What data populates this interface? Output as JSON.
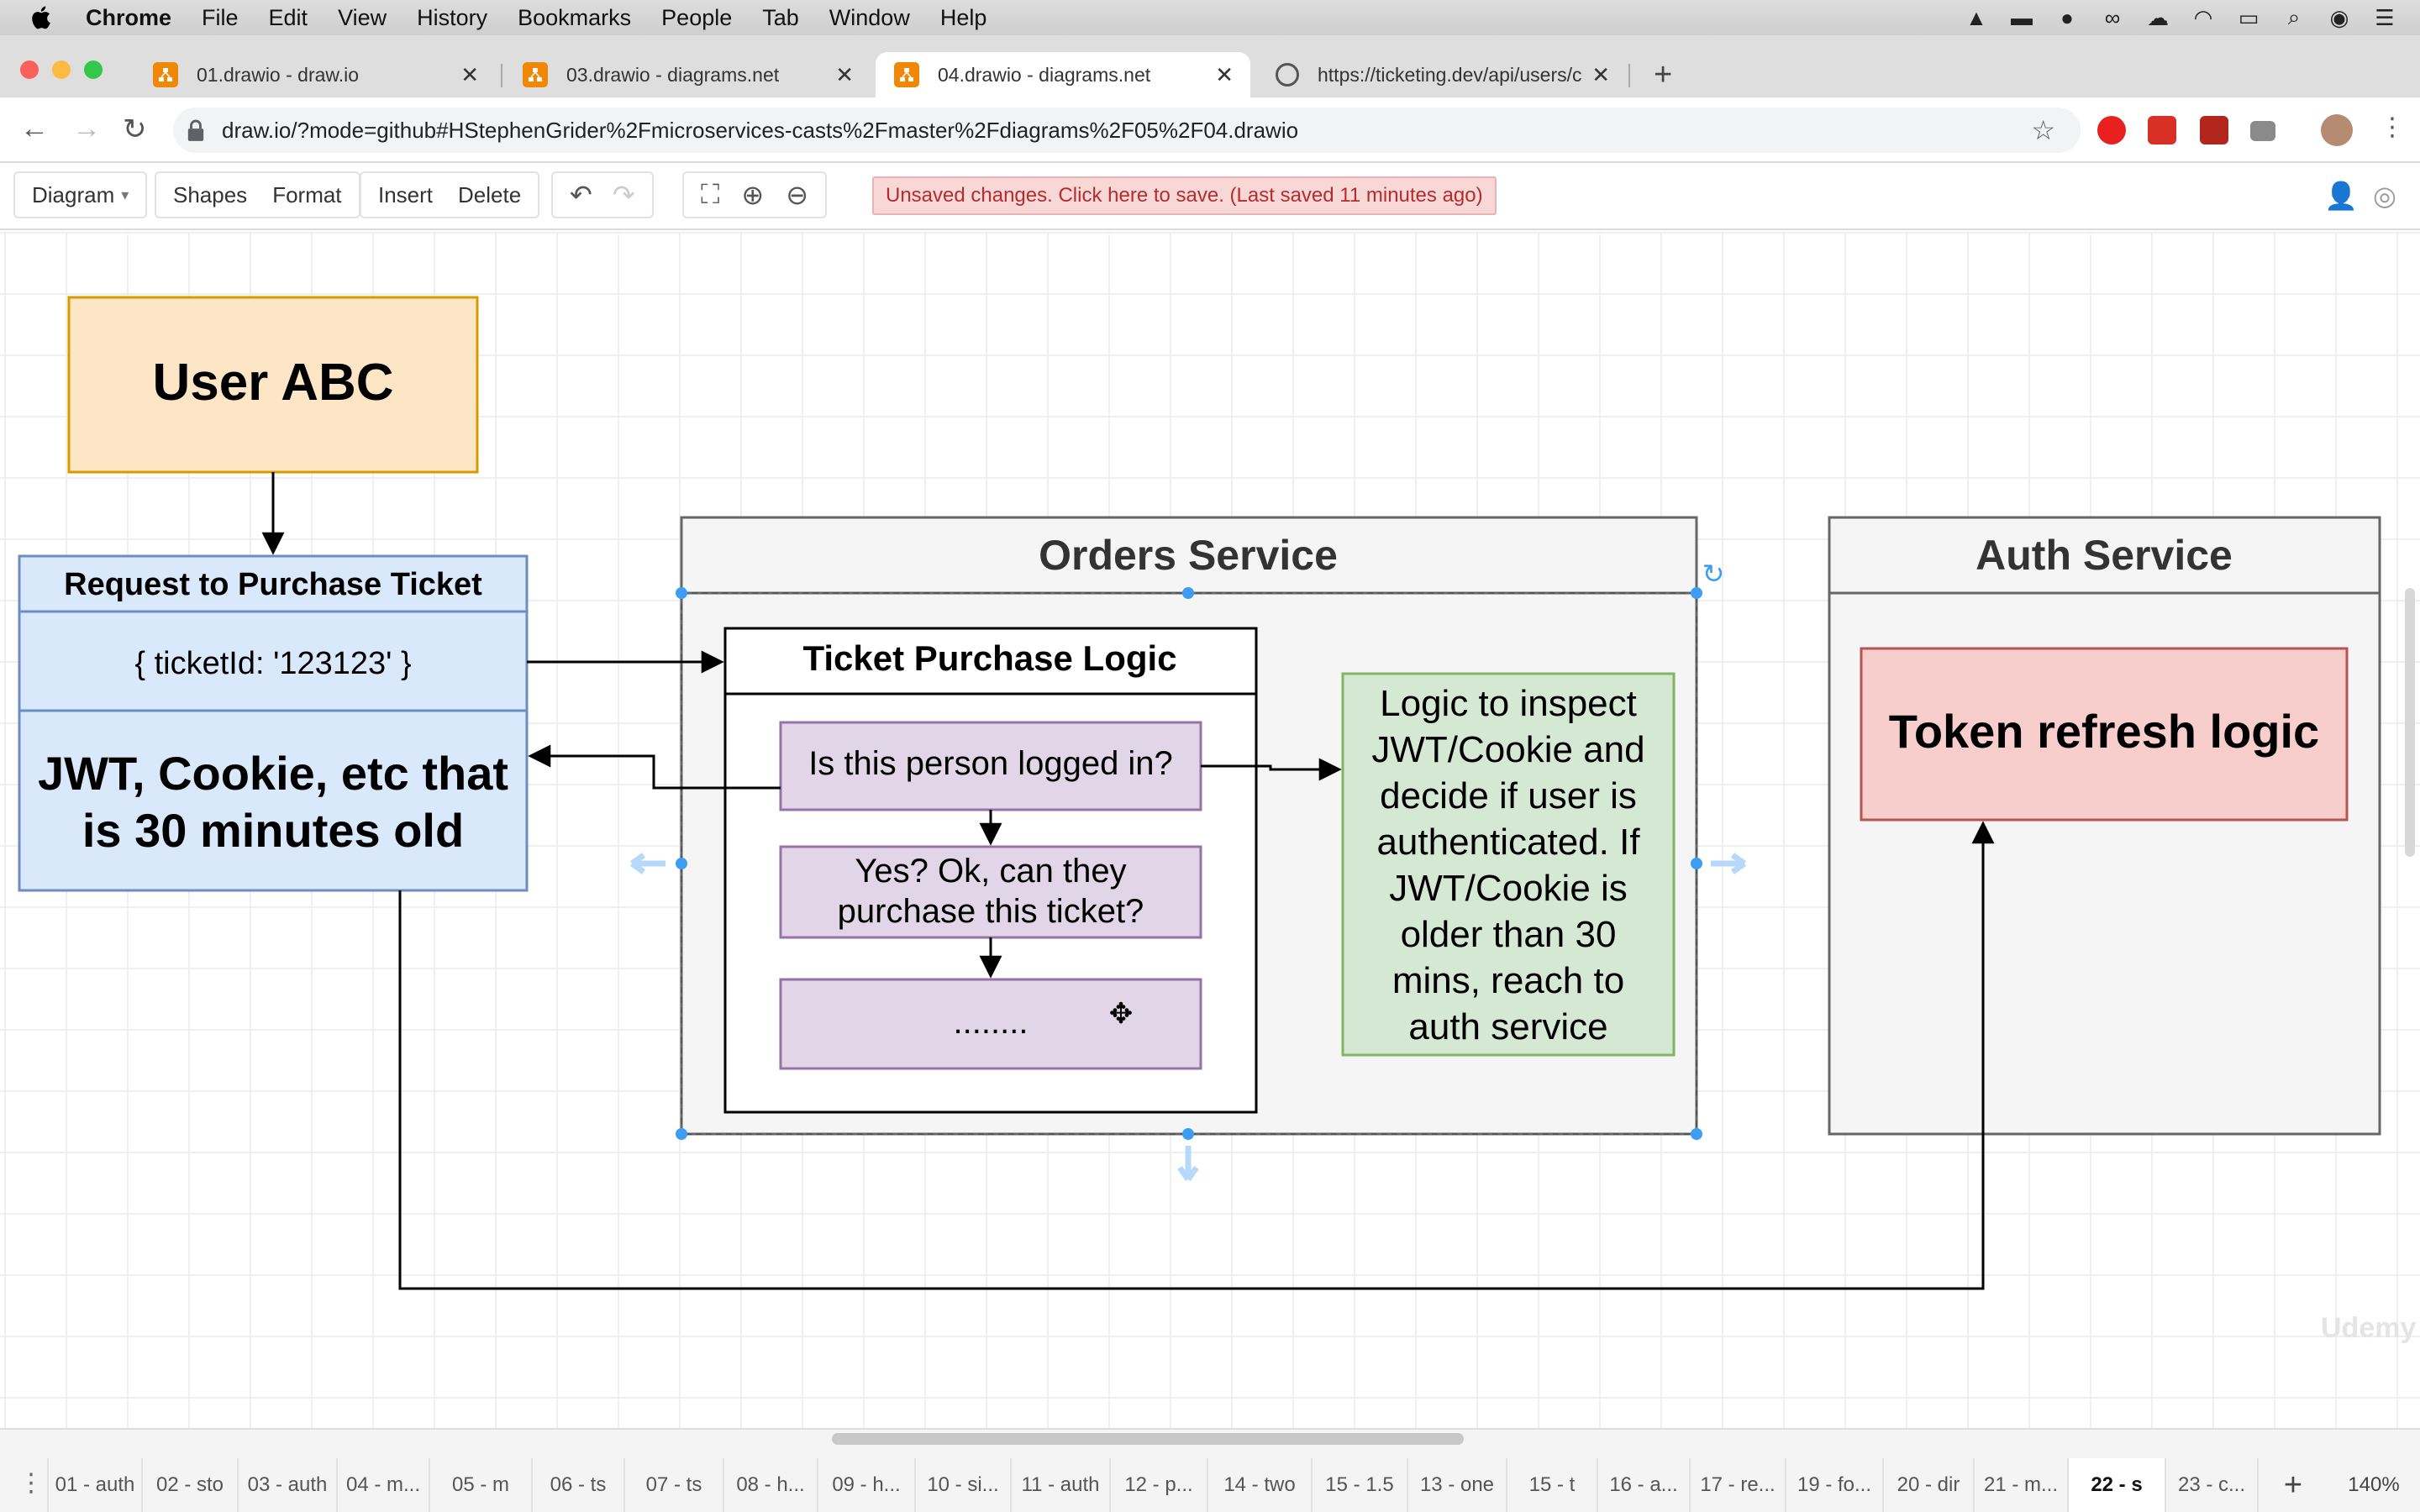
{
  "menubar": {
    "items": [
      "Chrome",
      "File",
      "Edit",
      "View",
      "History",
      "Bookmarks",
      "People",
      "Tab",
      "Window",
      "Help"
    ]
  },
  "tabs": [
    {
      "title": "01.drawio - draw.io",
      "icon": "drawio-icon"
    },
    {
      "title": "03.drawio - diagrams.net",
      "icon": "drawio-icon"
    },
    {
      "title": "04.drawio - diagrams.net",
      "icon": "drawio-icon",
      "active": true
    },
    {
      "title": "https://ticketing.dev/api/users/c",
      "icon": "globe-icon"
    }
  ],
  "address": {
    "url": "draw.io/?mode=github#HStephenGrider%2Fmicroservices-casts%2Fmaster%2Fdiagrams%2F05%2F04.drawio"
  },
  "toolbar": {
    "diagram": "Diagram",
    "shapes": "Shapes",
    "format": "Format",
    "insert": "Insert",
    "delete": "Delete",
    "unsaved": "Unsaved changes. Click here to save. (Last saved 11 minutes ago)"
  },
  "diagram": {
    "user_box": "User ABC",
    "request_title": "Request to Purchase Ticket",
    "request_body": "{ ticketId: '123123' }",
    "jwt_line1": "JWT, Cookie, etc that",
    "jwt_line2": "is 30 minutes old",
    "orders_title": "Orders Service",
    "logic_title": "Ticket Purchase Logic",
    "step1": "Is this person logged in?",
    "step2_line1": "Yes? Ok, can they",
    "step2_line2": "purchase this ticket?",
    "step3": "........",
    "inspect_lines": [
      "Logic to inspect",
      "JWT/Cookie and",
      "decide if user is",
      "authenticated.  If",
      "JWT/Cookie is",
      "older than 30",
      "mins, reach to",
      "auth service"
    ],
    "auth_title": "Auth Service",
    "token_refresh": "Token refresh logic",
    "colors": {
      "user": "#fce6c6",
      "request": "#dae8fc",
      "step": "#e1d5e7",
      "inspect": "#d5e8d4",
      "token": "#f8cecc",
      "service": "#f5f5f5"
    }
  },
  "pages": [
    "01 - auth",
    "02 - sto",
    "03 - auth",
    "04 - m...",
    "05 - m",
    "06 - ts",
    "07 - ts",
    "08 - h...",
    "09 - h...",
    "10 - si...",
    "11 - auth",
    "12 - p...",
    "14 - two",
    "15 - 1.5",
    "13 - one",
    "15 - t",
    "16 - a...",
    "17 - re...",
    "19 - fo...",
    "20 - dir",
    "21 - m...",
    "22 - s",
    "23 - c..."
  ],
  "active_page": "22 - s",
  "zoom": "140%",
  "watermark": "Udemy"
}
